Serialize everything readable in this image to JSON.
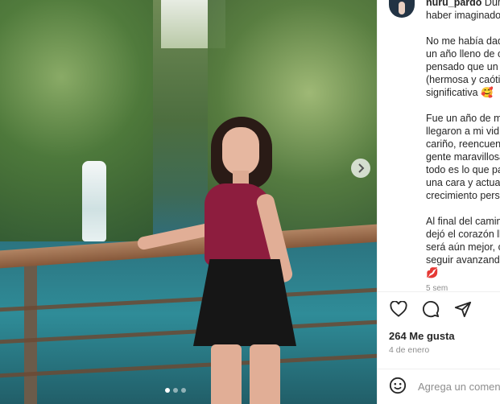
{
  "post": {
    "username": "nuru_pardo",
    "caption_lines": [
      " Dum",
      "haber imaginado",
      "",
      "No me había dad",
      "un año lleno de c",
      "pensado que un",
      "(hermosa y caótic",
      "significativa 🥰",
      "",
      "Fue un año de m",
      "llegaron a mi vid",
      "cariño, reencuent",
      "gente maravillosa",
      "todo es lo que pa",
      "una cara y actuar",
      "crecimiento perso",
      "",
      "Al final del camin",
      "dejó el corazón ll",
      "será aún mejor, c",
      "seguir avanzando",
      "💋"
    ],
    "time_ago": "5 sem",
    "likes": "264 Me gusta",
    "date": "4 de enero"
  },
  "carousel": {
    "next_icon": "chevron-right-icon",
    "dots": 3,
    "active_dot": 0
  },
  "actions": {
    "like_icon": "heart-icon",
    "comment_icon": "comment-icon",
    "share_icon": "send-icon"
  },
  "comment_box": {
    "placeholder": "Agrega un comentario...",
    "emoji_icon": "emoji-icon"
  }
}
